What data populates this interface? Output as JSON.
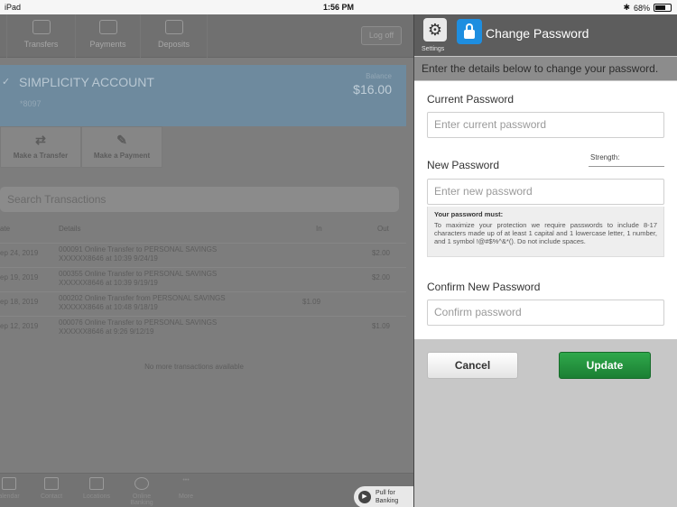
{
  "status_bar": {
    "device": "iPad",
    "time": "1:56 PM",
    "battery": "68%"
  },
  "nav": {
    "tabs": [
      "Transfers",
      "Payments",
      "Deposits"
    ],
    "logoff": "Log off"
  },
  "account": {
    "name": "SIMPLICITY ACCOUNT",
    "number": "*8097",
    "balance_label": "Balance",
    "balance": "$16.00"
  },
  "actions": [
    "Make a Transfer",
    "Make a Payment"
  ],
  "search": {
    "placeholder": "Search Transactions"
  },
  "transactions": {
    "headers": {
      "date": "ate",
      "details": "Details",
      "in": "In",
      "out": "Out"
    },
    "rows": [
      {
        "date": "ep 24, 2019",
        "line1": "000091 Online Transfer to PERSONAL SAVINGS",
        "line2": "XXXXXX8646 at 10:39 9/24/19",
        "in": "",
        "out": "$2.00"
      },
      {
        "date": "ep 19, 2019",
        "line1": "000355 Online Transfer to PERSONAL SAVINGS",
        "line2": "XXXXXX8646 at 10:39 9/19/19",
        "in": "",
        "out": "$2.00"
      },
      {
        "date": "ep 18, 2019",
        "line1": "000202 Online Transfer from PERSONAL SAVINGS",
        "line2": "XXXXXX8646 at 10:48 9/18/19",
        "in": "$1.09",
        "out": ""
      },
      {
        "date": "ep 12, 2019",
        "line1": "000076 Online Transfer to PERSONAL SAVINGS",
        "line2": "XXXXXX8646 at 9:26 9/12/19",
        "in": "",
        "out": "$1.09"
      }
    ],
    "empty_note": "No more transactions available"
  },
  "bottom_bar": {
    "items": [
      "alendar",
      "Contact",
      "Locations",
      "Online Banking",
      "More"
    ],
    "pull_label": "Pull for Banking"
  },
  "change_password": {
    "settings_label": "Settings",
    "title": "Change Password",
    "subtitle": "Enter the details below to change your password.",
    "current_label": "Current Password",
    "current_placeholder": "Enter current password",
    "new_label": "New Password",
    "strength_label": "Strength:",
    "new_placeholder": "Enter new password",
    "rules_title": "Your password must:",
    "rules_body": "To maximize your protection we require passwords to include 8-17 characters made up of at least 1 capital and 1 lowercase letter, 1 number, and 1 symbol !@#$%^&*(). Do not include spaces.",
    "confirm_label": "Confirm New Password",
    "confirm_placeholder": "Confirm password",
    "cancel": "Cancel",
    "update": "Update"
  },
  "colors": {
    "update_green": "#1e8a39",
    "lock_blue": "#1e8ee0"
  }
}
